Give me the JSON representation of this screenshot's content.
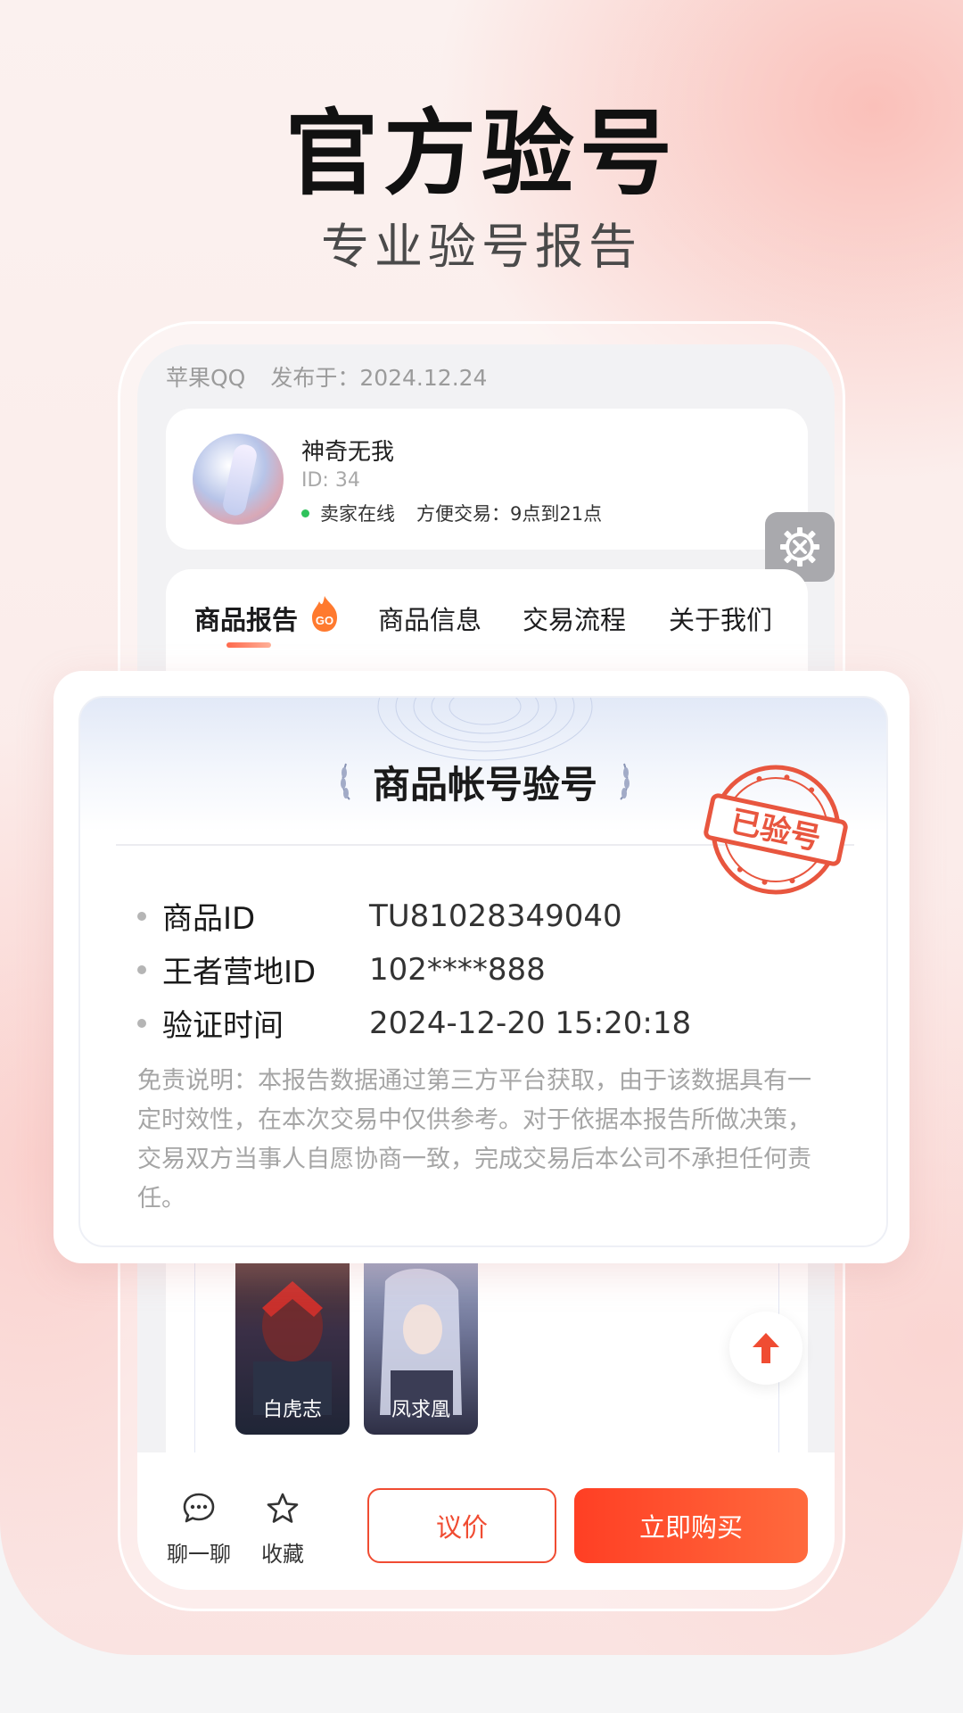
{
  "promo": {
    "headline": "官方验号",
    "subheadline": "专业验号报告"
  },
  "listing": {
    "platform": "苹果QQ",
    "published": "发布于：2024.12.24"
  },
  "seller": {
    "name": "神奇无我",
    "id": "ID: 34",
    "online_status": "卖家在线",
    "trade_hours": "方便交易：9点到21点"
  },
  "tabs": [
    {
      "label": "商品报告",
      "badge": "GO"
    },
    {
      "label": "商品信息"
    },
    {
      "label": "交易流程"
    },
    {
      "label": "关于我们"
    }
  ],
  "report": {
    "title": "商品帐号验号",
    "stamp": "已验号",
    "rows": [
      {
        "key": "商品ID",
        "value": "TU81028349040"
      },
      {
        "key": "王者营地ID",
        "value": "102****888"
      },
      {
        "key": "验证时间",
        "value": "2024-12-20 15:20:18"
      }
    ],
    "disclaimer": "免责说明：本报告数据通过第三方平台获取，由于该数据具有一定时效性，在本次交易中仅供参考。对于依据本报告所做决策，交易双方当事人自愿协商一致，完成交易后本公司不承担任何责任。"
  },
  "heroes": [
    {
      "name": "白虎志"
    },
    {
      "name": "凤求凰"
    }
  ],
  "actions": {
    "chat": "聊一聊",
    "favorite": "收藏",
    "negotiate": "议价",
    "buy": "立即购买"
  },
  "colors": {
    "accent": "#f04c32",
    "online": "#2fc25b",
    "stamp": "#e8563f"
  }
}
